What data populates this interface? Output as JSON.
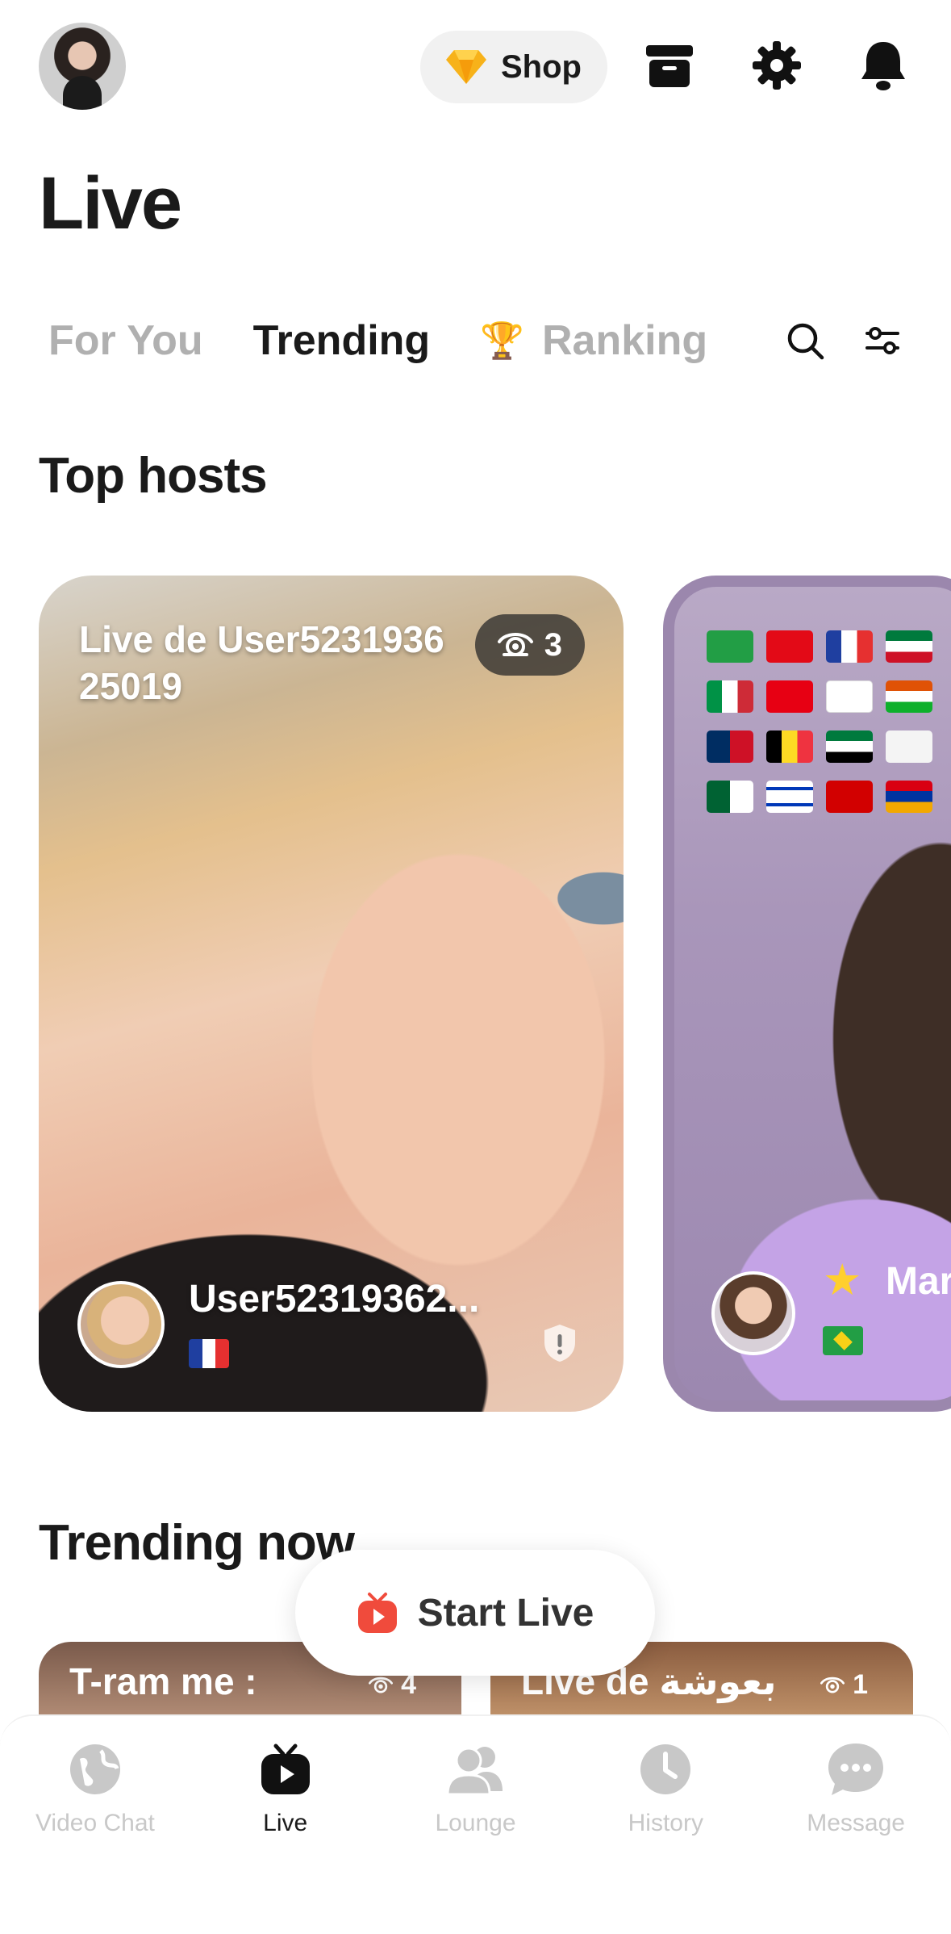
{
  "header": {
    "shop_label": "Shop",
    "icons": [
      "profile-avatar",
      "diamond-icon",
      "store-box-icon",
      "gear-icon",
      "bell-icon"
    ]
  },
  "page_title": "Live",
  "tabs": [
    {
      "label": "For You",
      "active": false
    },
    {
      "label": "Trending",
      "active": true
    },
    {
      "label": "Ranking",
      "active": false,
      "icon": "trophy"
    }
  ],
  "sections": {
    "top_hosts": "Top hosts",
    "trending_now": "Trending now"
  },
  "top_hosts": [
    {
      "title": "Live de User523193625019",
      "viewers": "3",
      "host_name": "User52319362...",
      "flag": "FR"
    },
    {
      "host_name": "Mar",
      "flag": "BR",
      "star": true
    }
  ],
  "start_live_label": "Start Live",
  "trending": [
    {
      "title": "T-ram me :",
      "viewers": "4"
    },
    {
      "title": "Live de بعوشة",
      "viewers": "1"
    }
  ],
  "nav": [
    {
      "label": "Video Chat",
      "active": false
    },
    {
      "label": "Live",
      "active": true
    },
    {
      "label": "Lounge",
      "active": false
    },
    {
      "label": "History",
      "active": false
    },
    {
      "label": "Message",
      "active": false
    }
  ],
  "colors": {
    "accent": "#1a1a1a",
    "inactive": "#b0b0b0",
    "live_red": "#f04b3c"
  }
}
